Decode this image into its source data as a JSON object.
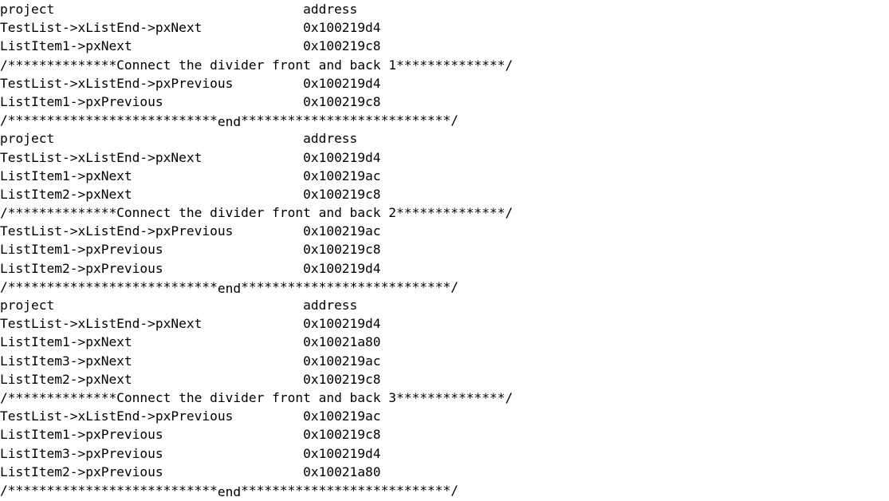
{
  "terminal": {
    "column_headers": {
      "project": "project",
      "address": "address"
    },
    "address_column": 39,
    "text_color": "#000000",
    "background_color": "#ffffff",
    "blocks": [
      {
        "header": {
          "project": "project",
          "address": "address"
        },
        "next_rows": [
          {
            "project": "TestList->xListEnd->pxNext",
            "address": "0x100219d4"
          },
          {
            "project": "ListItem1->pxNext",
            "address": "0x100219c8"
          }
        ],
        "divider": "/**************Connect the divider front and back 1**************/",
        "previous_rows": [
          {
            "project": "TestList->xListEnd->pxPrevious",
            "address": "0x100219d4"
          },
          {
            "project": "ListItem1->pxPrevious",
            "address": "0x100219c8"
          }
        ],
        "end_divider_left": "/***************************",
        "end_divider_token": "end",
        "end_divider_right": "***************************/"
      },
      {
        "header": {
          "project": "project",
          "address": "address"
        },
        "next_rows": [
          {
            "project": "TestList->xListEnd->pxNext",
            "address": "0x100219d4"
          },
          {
            "project": "ListItem1->pxNext",
            "address": "0x100219ac"
          },
          {
            "project": "ListItem2->pxNext",
            "address": "0x100219c8"
          }
        ],
        "divider": "/**************Connect the divider front and back 2**************/",
        "previous_rows": [
          {
            "project": "TestList->xListEnd->pxPrevious",
            "address": "0x100219ac"
          },
          {
            "project": "ListItem1->pxPrevious",
            "address": "0x100219c8"
          },
          {
            "project": "ListItem2->pxPrevious",
            "address": "0x100219d4"
          }
        ],
        "end_divider_left": "/***************************",
        "end_divider_token": "end",
        "end_divider_right": "***************************/"
      },
      {
        "header": {
          "project": "project",
          "address": "address"
        },
        "next_rows": [
          {
            "project": "TestList->xListEnd->pxNext",
            "address": "0x100219d4"
          },
          {
            "project": "ListItem1->pxNext",
            "address": "0x10021a80"
          },
          {
            "project": "ListItem3->pxNext",
            "address": "0x100219ac"
          },
          {
            "project": "ListItem2->pxNext",
            "address": "0x100219c8"
          }
        ],
        "divider": "/**************Connect the divider front and back 3**************/",
        "previous_rows": [
          {
            "project": "TestList->xListEnd->pxPrevious",
            "address": "0x100219ac"
          },
          {
            "project": "ListItem1->pxPrevious",
            "address": "0x100219c8"
          },
          {
            "project": "ListItem3->pxPrevious",
            "address": "0x100219d4"
          },
          {
            "project": "ListItem2->pxPrevious",
            "address": "0x10021a80"
          }
        ],
        "end_divider_left": "/***************************",
        "end_divider_token": "end",
        "end_divider_right": "***************************/"
      }
    ]
  }
}
